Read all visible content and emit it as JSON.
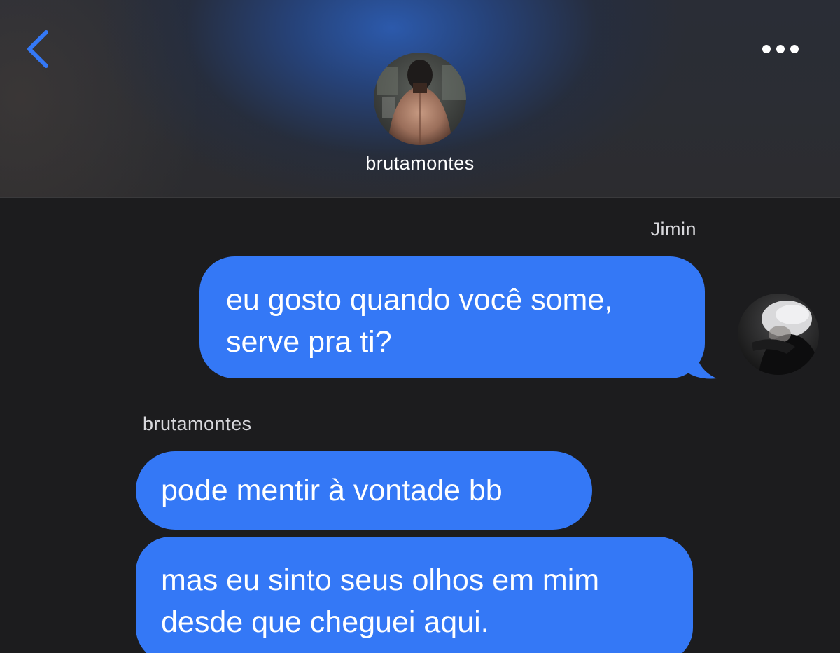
{
  "header": {
    "back_icon": "chevron-left-icon",
    "more_icon": "ellipsis-icon",
    "contact_name": "brutamontes",
    "accent_color": "#3478f6"
  },
  "messages": [
    {
      "direction": "outgoing",
      "sender": "Jimin",
      "lines": [
        "eu gosto quando você some,",
        "serve pra ti?"
      ]
    },
    {
      "direction": "incoming",
      "sender": "brutamontes",
      "lines": [
        "pode mentir à vontade bb"
      ]
    },
    {
      "direction": "incoming",
      "lines": [
        "mas eu sinto seus olhos em mim",
        "desde que cheguei aqui."
      ]
    }
  ]
}
